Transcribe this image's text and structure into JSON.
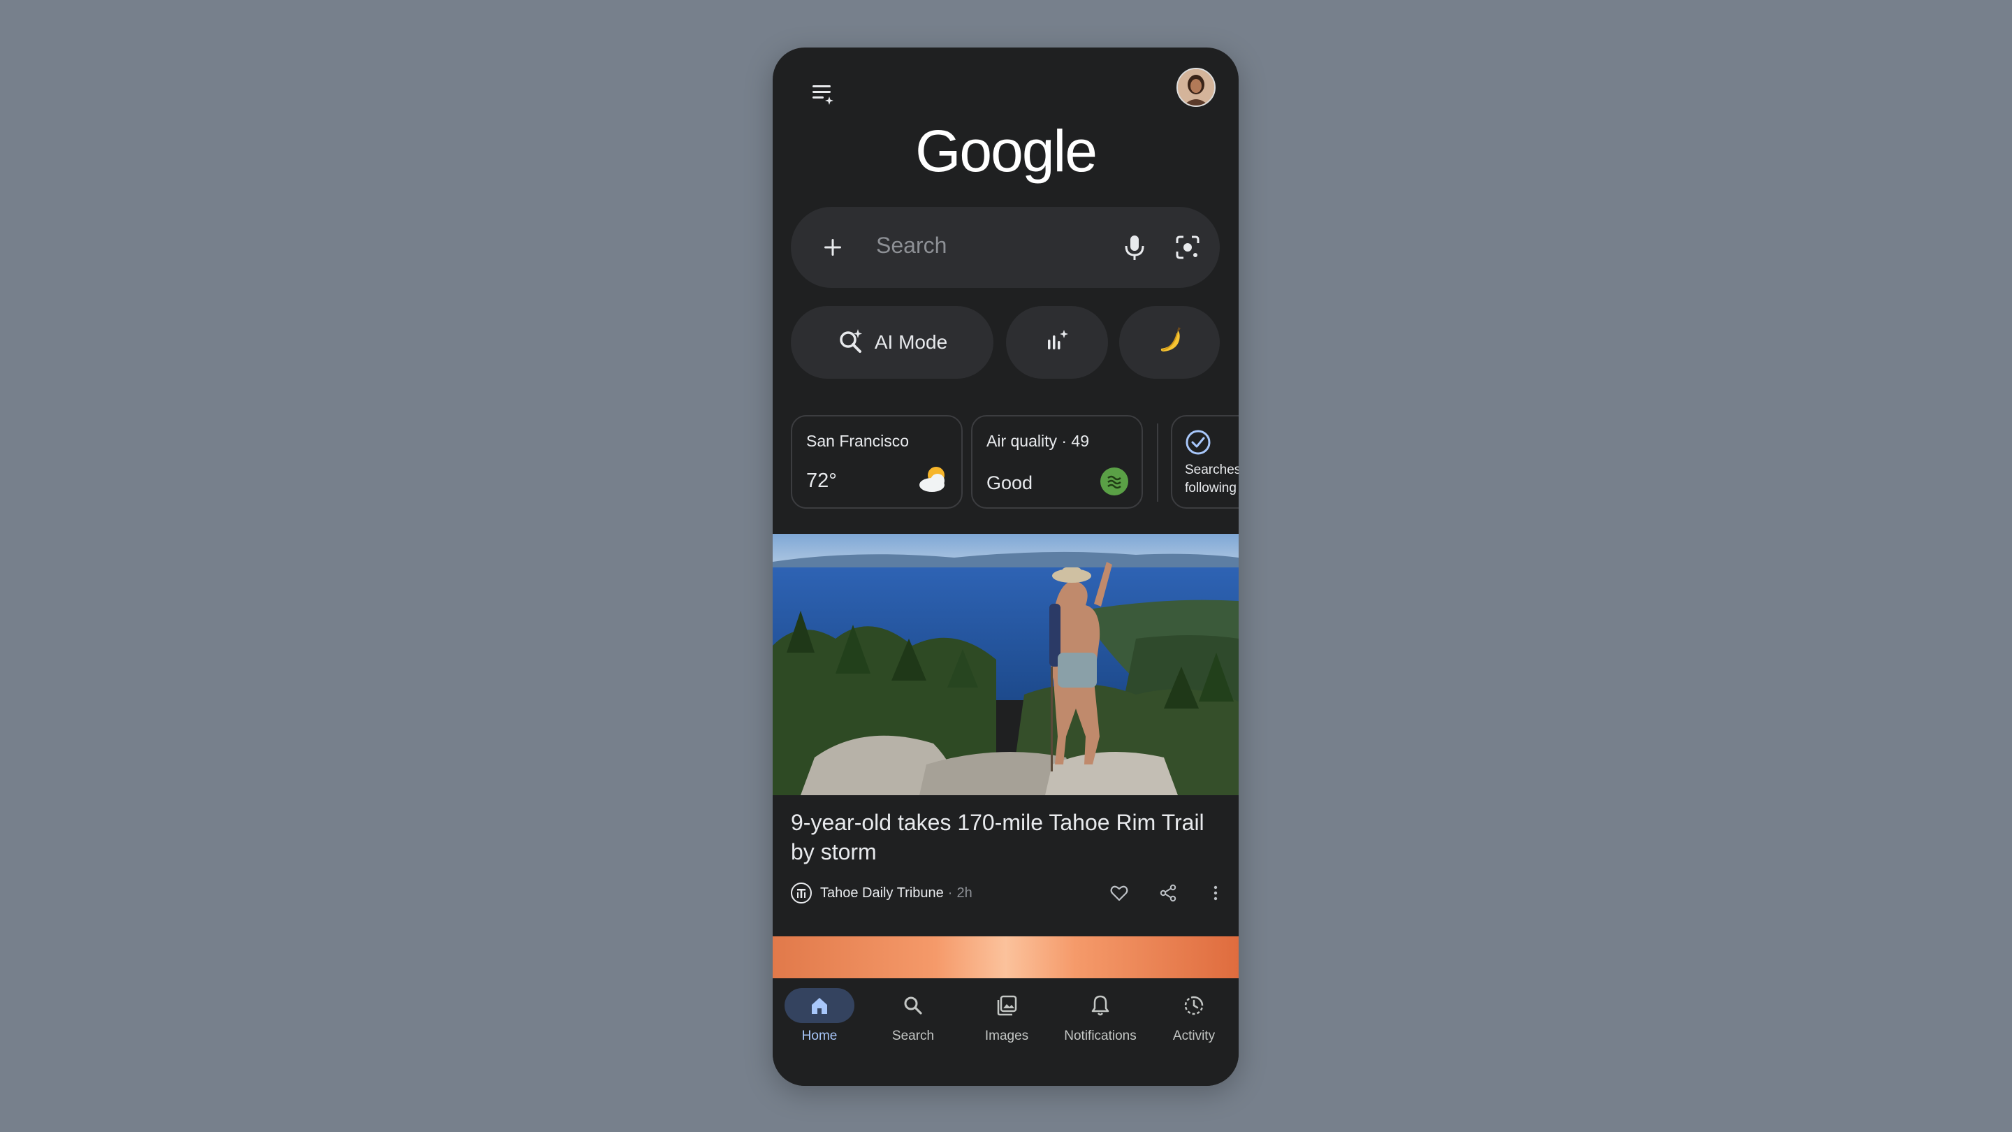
{
  "app": {
    "logo_text": "Google",
    "icons": {
      "menu": "menu-sparkle-icon",
      "avatar": "profile-avatar"
    }
  },
  "search": {
    "placeholder": "Search",
    "icons": [
      "plus-icon",
      "mic-icon",
      "lens-icon"
    ]
  },
  "chips": {
    "ai_mode_label": "AI Mode",
    "icons": [
      "ai-search-icon",
      "audio-sparkle-icon",
      "banana-icon"
    ]
  },
  "cards": {
    "weather": {
      "city": "San Francisco",
      "temp": "72°",
      "icon": "partly-cloudy-icon"
    },
    "air": {
      "title": "Air quality · 49",
      "status": "Good",
      "icon": "air-quality-badge-icon"
    },
    "follow": {
      "line1": "Searches",
      "line2": "following"
    }
  },
  "article": {
    "headline": "9-year-old takes 170-mile Tahoe Rim Trail by storm",
    "source": "Tahoe Daily Tribune",
    "separator": "·",
    "time": "2h",
    "actions": [
      "heart-icon",
      "share-icon",
      "more-icon"
    ]
  },
  "nav": {
    "items": [
      {
        "label": "Home",
        "icon": "home-icon",
        "active": true
      },
      {
        "label": "Search",
        "icon": "search-icon",
        "active": false
      },
      {
        "label": "Images",
        "icon": "images-icon",
        "active": false
      },
      {
        "label": "Notifications",
        "icon": "bell-icon",
        "active": false
      },
      {
        "label": "Activity",
        "icon": "activity-icon",
        "active": false
      }
    ]
  },
  "colors": {
    "background": "#77808c",
    "surface": "#1f2021",
    "chip": "#2d2e31",
    "accent": "#a8c7fa",
    "air_good": "#5aa046"
  }
}
